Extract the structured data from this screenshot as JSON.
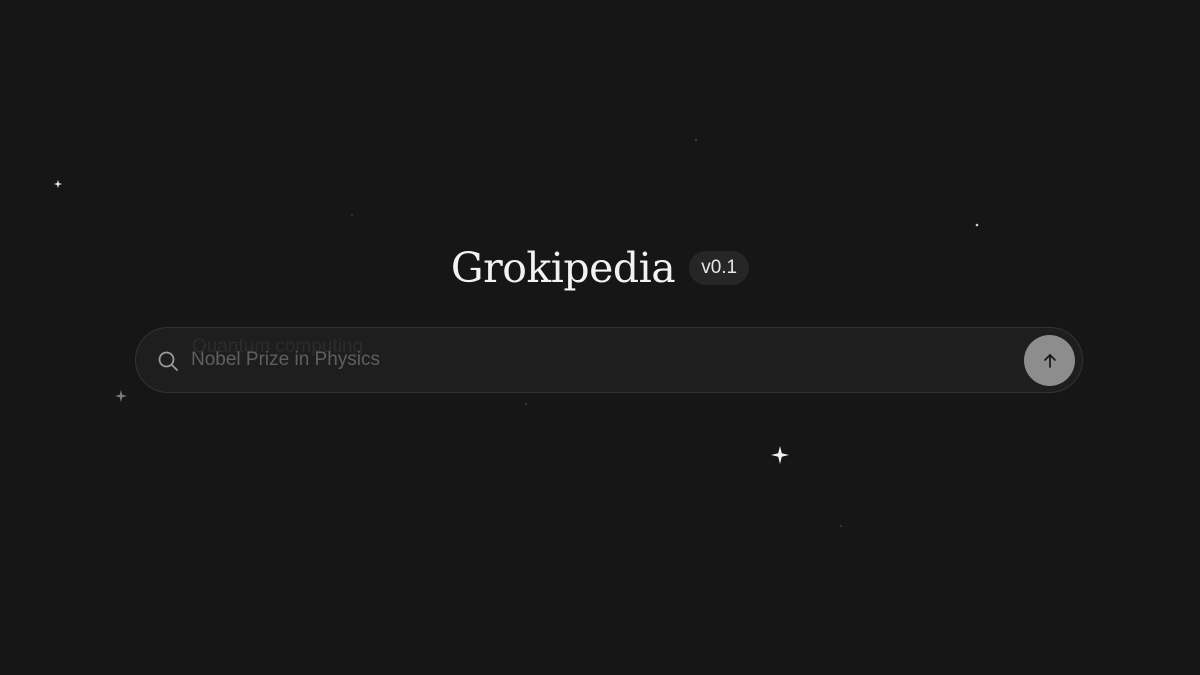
{
  "brand": {
    "title": "Grokipedia",
    "version_badge": "v0.1"
  },
  "search": {
    "previous_placeholder": "Quantum computing",
    "placeholder": "Nobel Prize in Physics",
    "value": ""
  },
  "icons": {
    "search": "search-icon",
    "submit": "arrow-up-icon",
    "decoration": "sparkle-icon"
  },
  "colors": {
    "background": "#161616",
    "search_bar": "#1e1e1e",
    "search_border": "#333333",
    "submit_button": "#8d8d8d",
    "badge_background": "#262626",
    "title_text": "#f2f2f2"
  }
}
